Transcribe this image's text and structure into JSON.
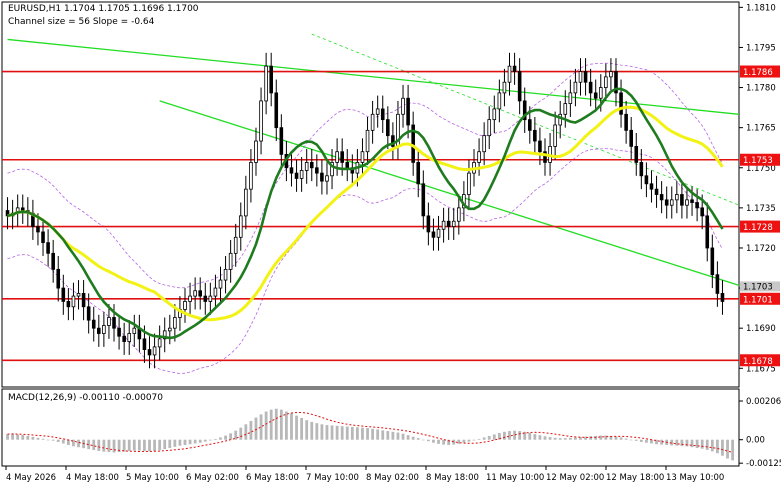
{
  "header": {
    "symbol_line": "EURUSD,H1  1.1704 1.1705 1.1696 1.1700",
    "channel_line": "Channel size = 56 Slope = -0.64"
  },
  "macd": {
    "label": "MACD(12,26,9) -0.00110 -0.00070"
  },
  "colors": {
    "background": "#ffffff",
    "candle": "#000000",
    "ma_fast": "#1e7b1e",
    "ma_slow": "#f2f214",
    "channel": "#22dd22",
    "envelope": "#b766e6",
    "level_line": "#e01010",
    "price_tag": "#ee1111",
    "macd_hist": "#b8b8b8",
    "macd_signal": "#e01010"
  },
  "chart_data": {
    "type": "candlestick",
    "symbol": "EURUSD",
    "timeframe": "H1",
    "ylim": [
      1.1668,
      1.1812
    ],
    "price_ticks": [
      "1.1810",
      "1.1795",
      "1.1780",
      "1.1765",
      "1.1750",
      "1.1735",
      "1.1720",
      "1.1705",
      "1.1690",
      "1.1675"
    ],
    "time_labels": [
      "4 May 2026",
      "4 May 18:00",
      "5 May 10:00",
      "6 May 02:00",
      "6 May 18:00",
      "7 May 10:00",
      "8 May 02:00",
      "8 May 18:00",
      "11 May 10:00",
      "12 May 02:00",
      "12 May 18:00",
      "13 May 10:00"
    ],
    "levels": [
      {
        "price": 1.1786,
        "label": "1.1786"
      },
      {
        "price": 1.1753,
        "label": "1.1753"
      },
      {
        "price": 1.1728,
        "label": "1.1728"
      },
      {
        "price": 1.1701,
        "label": "1.1701"
      },
      {
        "price": 1.1678,
        "label": "1.1678"
      }
    ],
    "current_price": {
      "price": 1.1703,
      "label": "1.1703"
    },
    "closes": [
      1.1732,
      1.1733,
      1.1735,
      1.1734,
      1.1733,
      1.1728,
      1.1726,
      1.1722,
      1.1718,
      1.1712,
      1.1705,
      1.17,
      1.1698,
      1.1702,
      1.1703,
      1.1698,
      1.1693,
      1.169,
      1.1688,
      1.1691,
      1.1694,
      1.169,
      1.1687,
      1.1685,
      1.1688,
      1.169,
      1.1686,
      1.1682,
      1.168,
      1.1683,
      1.1686,
      1.1689,
      1.169,
      1.1694,
      1.1697,
      1.17,
      1.1702,
      1.1704,
      1.1702,
      1.17,
      1.1702,
      1.1705,
      1.1708,
      1.1712,
      1.1718,
      1.1724,
      1.1732,
      1.1742,
      1.1752,
      1.176,
      1.1775,
      1.1788,
      1.1778,
      1.1765,
      1.1755,
      1.175,
      1.1748,
      1.1746,
      1.1749,
      1.1752,
      1.175,
      1.1748,
      1.1745,
      1.1747,
      1.1752,
      1.1756,
      1.1752,
      1.175,
      1.1748,
      1.1752,
      1.1756,
      1.1764,
      1.177,
      1.1772,
      1.1768,
      1.1762,
      1.1758,
      1.177,
      1.1776,
      1.1766,
      1.1752,
      1.1744,
      1.1732,
      1.1726,
      1.1724,
      1.1727,
      1.173,
      1.1728,
      1.173,
      1.1735,
      1.174,
      1.1748,
      1.1752,
      1.1756,
      1.1762,
      1.1768,
      1.1772,
      1.1778,
      1.1782,
      1.1788,
      1.1786,
      1.1775,
      1.1768,
      1.1764,
      1.176,
      1.1756,
      1.1752,
      1.1758,
      1.1766,
      1.177,
      1.1774,
      1.1778,
      1.1782,
      1.1786,
      1.1782,
      1.1778,
      1.1776,
      1.178,
      1.1784,
      1.1786,
      1.1778,
      1.177,
      1.1764,
      1.1758,
      1.1752,
      1.1747,
      1.1744,
      1.1742,
      1.174,
      1.1738,
      1.1736,
      1.1738,
      1.174,
      1.1736,
      1.1738,
      1.1737,
      1.1735,
      1.1732,
      1.172,
      1.171,
      1.1703,
      1.17
    ],
    "macd_ylim": [
      -0.0014,
      0.0027
    ],
    "macd_ticks": [
      "0.00206",
      "0.00",
      "-0.00125"
    ],
    "macd_hist": [
      0.0003,
      0.00032,
      0.00028,
      0.00025,
      0.0002,
      0.00015,
      0.0001,
      5e-05,
      0.0,
      -5e-05,
      -0.00012,
      -0.0002,
      -0.00028,
      -0.00035,
      -0.0004,
      -0.00045,
      -0.0005,
      -0.00055,
      -0.0006,
      -0.00064,
      -0.00066,
      -0.00068,
      -0.00066,
      -0.00064,
      -0.0006,
      -0.00058,
      -0.00058,
      -0.0006,
      -0.00062,
      -0.0006,
      -0.00056,
      -0.0005,
      -0.00044,
      -0.00038,
      -0.00032,
      -0.00028,
      -0.00024,
      -0.0002,
      -0.00016,
      -0.0001,
      -4e-05,
      4e-05,
      0.00012,
      0.00022,
      0.00034,
      0.00048,
      0.00064,
      0.00082,
      0.001,
      0.00118,
      0.00135,
      0.0015,
      0.0016,
      0.00165,
      0.0016,
      0.0015,
      0.0014,
      0.00128,
      0.00116,
      0.00104,
      0.00095,
      0.00088,
      0.00082,
      0.00078,
      0.00076,
      0.00074,
      0.00072,
      0.0007,
      0.00068,
      0.00066,
      0.00064,
      0.00062,
      0.00058,
      0.00055,
      0.0005,
      0.00046,
      0.00042,
      0.00038,
      0.00032,
      0.00024,
      0.00016,
      8e-05,
      0.0,
      -8e-05,
      -0.00016,
      -0.00022,
      -0.00026,
      -0.00028,
      -0.00026,
      -0.00022,
      -0.00016,
      -0.0001,
      -4e-05,
      4e-05,
      0.00012,
      0.0002,
      0.00028,
      0.00036,
      0.00042,
      0.00046,
      0.00048,
      0.00046,
      0.00042,
      0.00036,
      0.0003,
      0.00024,
      0.00018,
      0.00014,
      0.0001,
      8e-05,
      8e-05,
      0.0001,
      0.00012,
      0.00014,
      0.00016,
      0.00018,
      0.0002,
      0.00022,
      0.00022,
      0.0002,
      0.00016,
      0.00012,
      6e-05,
      0.0,
      -6e-05,
      -0.00012,
      -0.00016,
      -0.0002,
      -0.00024,
      -0.00026,
      -0.00028,
      -0.0003,
      -0.00032,
      -0.00034,
      -0.00036,
      -0.0004,
      -0.00044,
      -0.00048,
      -0.00054,
      -0.00062,
      -0.00072,
      -0.00085,
      -0.001,
      -0.0011
    ]
  }
}
